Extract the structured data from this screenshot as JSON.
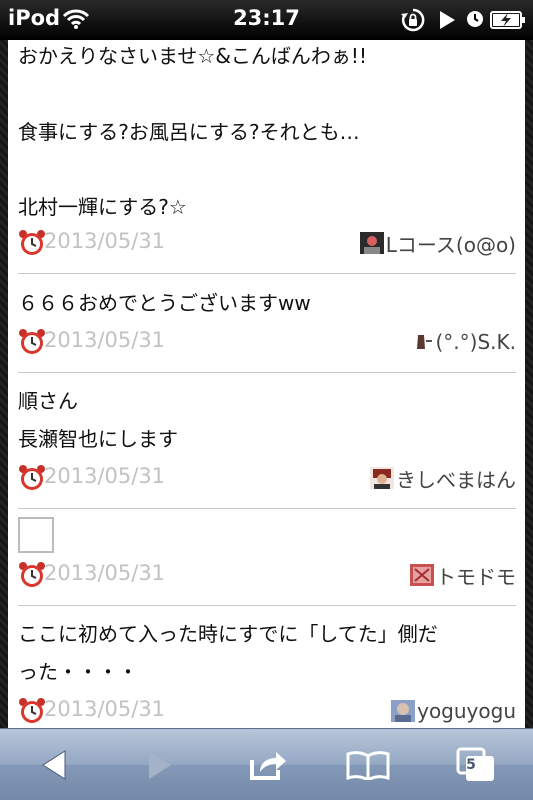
{
  "status_bar": {
    "carrier": "iPod",
    "time": "23:17",
    "icons": [
      "wifi-icon",
      "rotation-lock-icon",
      "play-icon",
      "clock-icon",
      "battery-charging-icon"
    ]
  },
  "posts": [
    {
      "lines": [
        "おかえりなさいませ☆&こんばんわぁ!!",
        "",
        "食事にする?お風呂にする?それとも…",
        "",
        "北村一輝にする?☆"
      ],
      "date": "2013/05/31",
      "author": "Lコース(o@o)",
      "avatar": "user-avatar"
    },
    {
      "lines": [
        "６６６おめでとうございますww"
      ],
      "date": "2013/05/31",
      "author": "(°.°)S.K.",
      "avatar": "user-avatar"
    },
    {
      "lines": [
        "順さん",
        "長瀬智也にします"
      ],
      "date": "2013/05/31",
      "author": "きしべまはん",
      "avatar": "user-avatar"
    },
    {
      "lines": [],
      "date": "2013/05/31",
      "author": "トモドモ",
      "avatar": "user-avatar",
      "image_placeholder": true
    },
    {
      "lines": [
        "ここに初めて入った時にすでに「してた」側だ",
        "った・・・・"
      ],
      "date": "2013/05/31",
      "author": "yoguyogu",
      "avatar": "user-avatar"
    }
  ],
  "toolbar": {
    "tabs_count": "5",
    "icons": [
      "back-icon",
      "forward-icon",
      "share-icon",
      "bookmarks-icon",
      "tabs-icon"
    ]
  },
  "colors": {
    "toolbar_top": "#b7c5d9",
    "toolbar_bottom": "#7489a8",
    "date_text": "#c2c2c2",
    "divider": "#c8c8c8"
  }
}
